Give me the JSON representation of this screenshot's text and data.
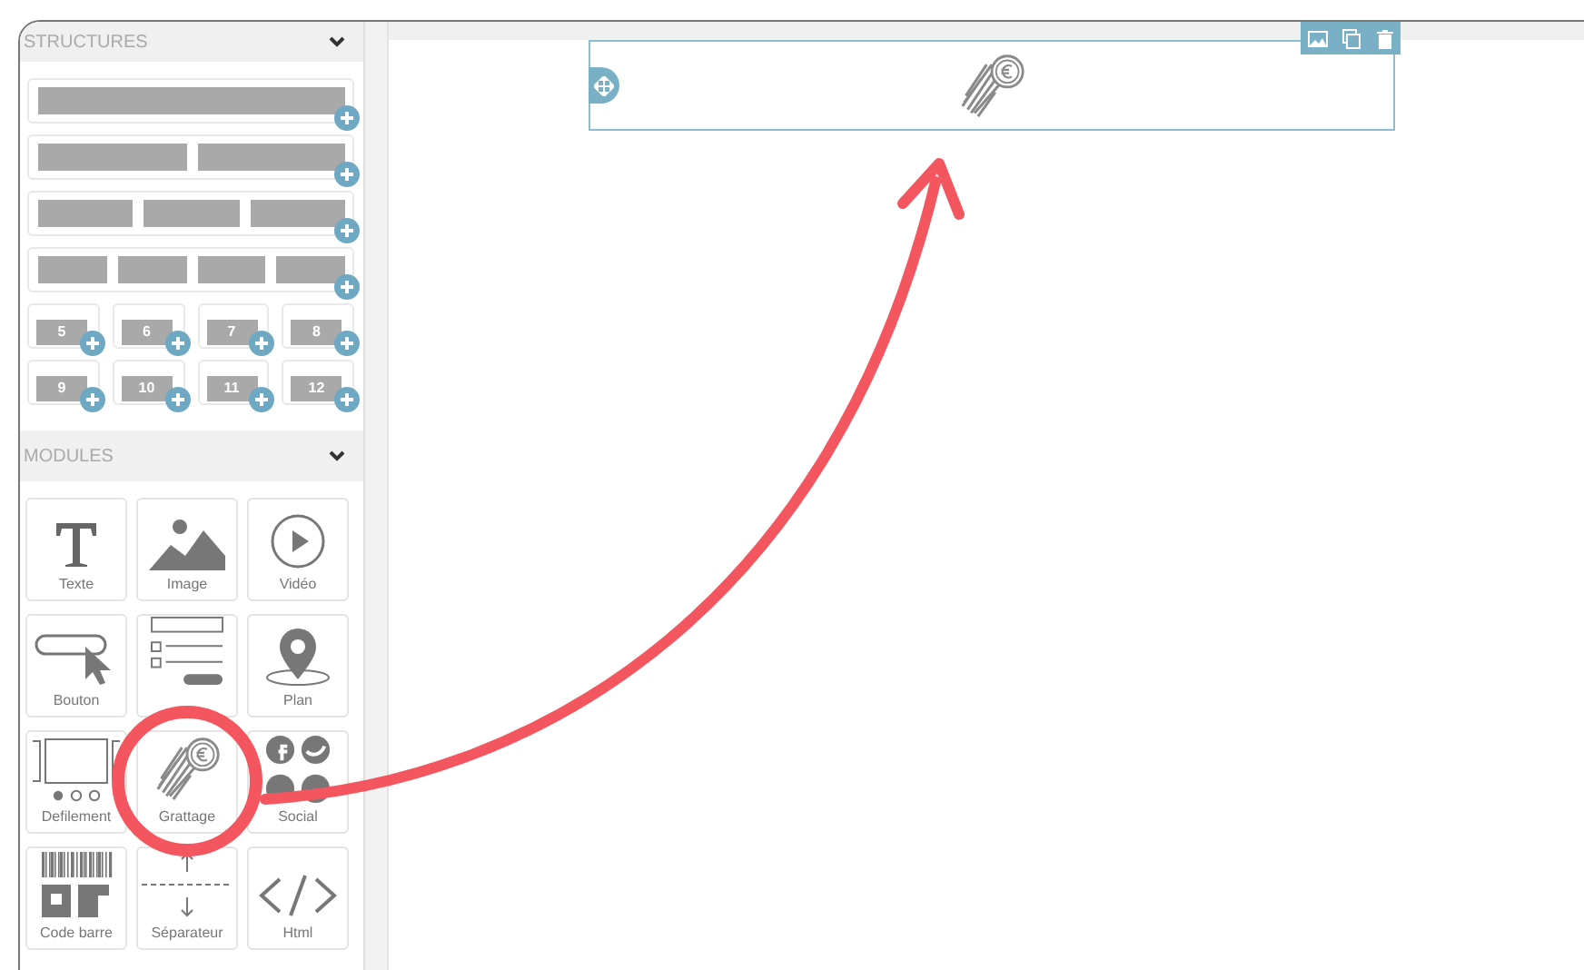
{
  "sidebar": {
    "structures": {
      "title": "STRUCTURES",
      "expanded": true,
      "numbered": [
        "5",
        "6",
        "7",
        "8",
        "9",
        "10",
        "11",
        "12"
      ]
    },
    "modules": {
      "title": "MODULES",
      "expanded": true,
      "items": [
        {
          "kind": "text",
          "label": "Texte"
        },
        {
          "kind": "image",
          "label": "Image"
        },
        {
          "kind": "video",
          "label": "Vidéo"
        },
        {
          "kind": "button",
          "label": "Bouton"
        },
        {
          "kind": "form"
        },
        {
          "kind": "map",
          "label": "Plan"
        },
        {
          "kind": "slider",
          "label": "Defilement"
        },
        {
          "kind": "scratch",
          "label": "Grattage"
        },
        {
          "kind": "social",
          "label": "Social"
        },
        {
          "kind": "barcode",
          "label": "Code barre"
        },
        {
          "kind": "separator",
          "label": "Séparateur"
        },
        {
          "kind": "html",
          "label": "Html"
        }
      ]
    }
  },
  "canvas": {
    "blocks": [
      {
        "kind": "scratch",
        "selected": true
      }
    ]
  }
}
